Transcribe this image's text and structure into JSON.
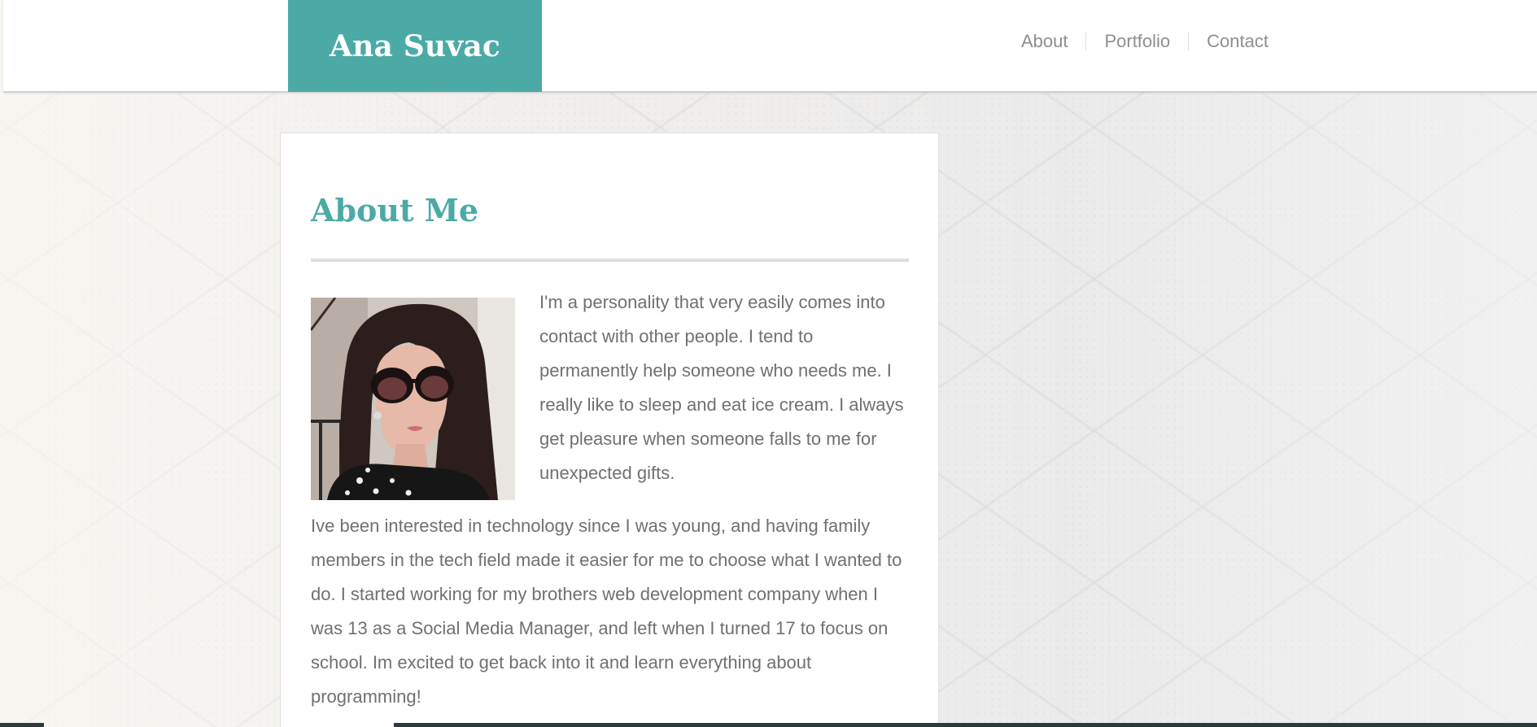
{
  "header": {
    "brand_name": "Ana Suvac",
    "brand_color": "#4caaa6",
    "nav": [
      {
        "label": "About"
      },
      {
        "label": "Portfolio"
      },
      {
        "label": "Contact"
      }
    ]
  },
  "about": {
    "title": "About Me",
    "intro": "I'm a personality that very easily comes into contact with other people. I tend to permanently help someone who needs me. I really like to sleep and eat ice cream. I always get pleasure when someone falls to me for unexpected gifts.",
    "body": "Ive been interested in technology since I was young, and having family members in the tech field made it easier for me to choose what I wanted to do. I started working for my brothers web development company when I was 13 as a Social Media Manager, and left when I turned 17 to focus on school. Im excited to get back into it and learn everything about programming!",
    "title_color": "#4caaa6",
    "text_color": "#707070"
  }
}
